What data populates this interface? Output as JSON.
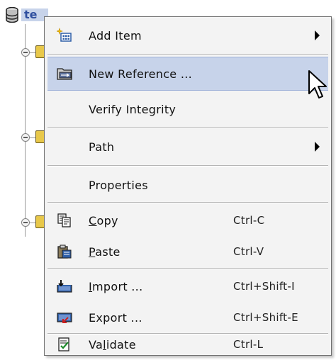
{
  "tree": {
    "root_label": "te"
  },
  "menu": {
    "items": [
      {
        "label": "Add Item",
        "icon": "add-item-icon",
        "has_submenu": true
      },
      {
        "label": "New Reference ...",
        "icon": "new-reference-icon",
        "highlighted": true
      },
      {
        "label": "Verify Integrity"
      },
      {
        "label": "Path",
        "has_submenu": true
      },
      {
        "label": "Properties"
      },
      {
        "label": "Copy",
        "mnemonic": "C",
        "rest": "opy",
        "icon": "copy-icon",
        "shortcut": "Ctrl-C"
      },
      {
        "label": "Paste",
        "mnemonic": "P",
        "rest": "aste",
        "icon": "paste-icon",
        "shortcut": "Ctrl-V"
      },
      {
        "label": "Import ...",
        "mnemonic": "I",
        "rest": "mport ...",
        "icon": "import-icon",
        "shortcut": "Ctrl+Shift-I"
      },
      {
        "label": "Export ...",
        "icon": "export-icon",
        "shortcut": "Ctrl+Shift-E"
      },
      {
        "label": "Validate",
        "pre": "Va",
        "mnemonic": "l",
        "rest": "idate",
        "icon": "validate-icon",
        "shortcut": "Ctrl-L"
      }
    ]
  },
  "colors": {
    "highlight": "#c7d3ea",
    "menu_bg": "#f3f3f3"
  }
}
